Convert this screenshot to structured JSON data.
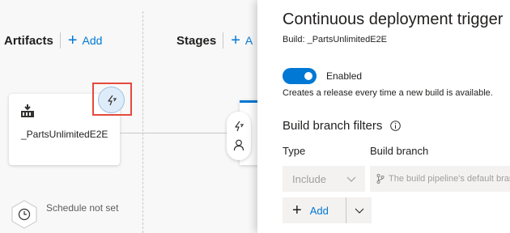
{
  "pipeline": {
    "artifacts": {
      "title": "Artifacts",
      "add_label": "Add"
    },
    "stages": {
      "title": "Stages",
      "add_label": "A"
    },
    "artifact_card": {
      "name": "_PartsUnlimitedE2E",
      "icon": "build-pipeline-icon"
    },
    "trigger_button": {
      "icon": "lightning-icon"
    },
    "stage_controls": {
      "trigger_icon": "lightning-icon",
      "approver_icon": "person-icon"
    },
    "schedule": {
      "label": "Schedule not set",
      "icon": "clock-icon"
    }
  },
  "panel": {
    "title": "Continuous deployment trigger",
    "subtitle": "Build: _PartsUnlimitedE2E",
    "toggle": {
      "label": "Enabled",
      "on": true
    },
    "toggle_description": "Creates a release every time a new build is available.",
    "branch_filters": {
      "title": "Build branch filters",
      "info_icon": "info-icon",
      "type_label": "Type",
      "branch_label": "Build branch",
      "type_value": "Include",
      "branch_placeholder": "The build pipeline's default branch",
      "add_label": "Add"
    }
  },
  "colors": {
    "accent": "#0078d4",
    "highlight": "#e34a3c"
  }
}
